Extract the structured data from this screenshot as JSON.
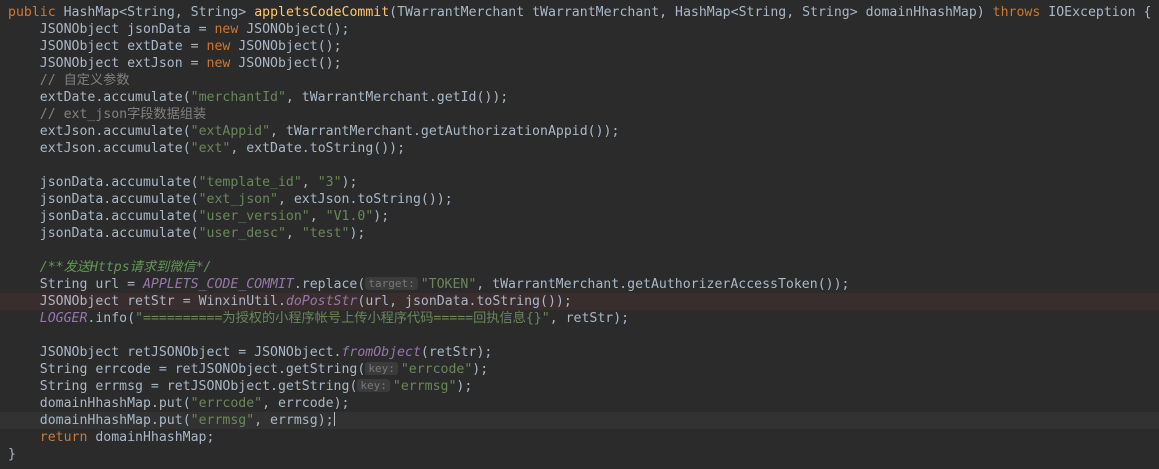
{
  "code_lines": [
    {
      "tokens": [
        [
          "kw",
          "public"
        ],
        [
          "plain",
          " "
        ],
        [
          "type",
          "HashMap"
        ],
        [
          "plain",
          "<"
        ],
        [
          "type",
          "String"
        ],
        [
          "plain",
          ", "
        ],
        [
          "type",
          "String"
        ],
        [
          "plain",
          "> "
        ],
        [
          "method",
          "appletsCodeCommit"
        ],
        [
          "plain",
          "("
        ],
        [
          "type",
          "TWarrantMerchant"
        ],
        [
          "plain",
          " tWarrantMerchant, "
        ],
        [
          "type",
          "HashMap"
        ],
        [
          "plain",
          "<"
        ],
        [
          "type",
          "String"
        ],
        [
          "plain",
          ", "
        ],
        [
          "type",
          "String"
        ],
        [
          "plain",
          "> domainHhashMap) "
        ],
        [
          "kw",
          "throws"
        ],
        [
          "plain",
          " "
        ],
        [
          "type",
          "IOException"
        ],
        [
          "plain",
          " {"
        ]
      ]
    },
    {
      "tokens": [
        [
          "plain",
          "    "
        ],
        [
          "type",
          "JSONObject"
        ],
        [
          "plain",
          " jsonData = "
        ],
        [
          "kw",
          "new"
        ],
        [
          "plain",
          " "
        ],
        [
          "type",
          "JSONObject"
        ],
        [
          "plain",
          "();"
        ]
      ]
    },
    {
      "tokens": [
        [
          "plain",
          "    "
        ],
        [
          "type",
          "JSONObject"
        ],
        [
          "plain",
          " extDate = "
        ],
        [
          "kw",
          "new"
        ],
        [
          "plain",
          " "
        ],
        [
          "type",
          "JSONObject"
        ],
        [
          "plain",
          "();"
        ]
      ]
    },
    {
      "tokens": [
        [
          "plain",
          "    "
        ],
        [
          "type",
          "JSONObject"
        ],
        [
          "plain",
          " extJson = "
        ],
        [
          "kw",
          "new"
        ],
        [
          "plain",
          " "
        ],
        [
          "type",
          "JSONObject"
        ],
        [
          "plain",
          "();"
        ]
      ]
    },
    {
      "tokens": [
        [
          "plain",
          "    "
        ],
        [
          "comment",
          "// 自定义参数"
        ]
      ]
    },
    {
      "tokens": [
        [
          "plain",
          "    extDate."
        ],
        [
          "call",
          "accumulate"
        ],
        [
          "plain",
          "("
        ],
        [
          "str",
          "\"merchantId\""
        ],
        [
          "plain",
          ", tWarrantMerchant."
        ],
        [
          "call",
          "getId"
        ],
        [
          "plain",
          "());"
        ]
      ]
    },
    {
      "tokens": [
        [
          "plain",
          "    "
        ],
        [
          "comment",
          "// ext_json字段数据组装"
        ]
      ]
    },
    {
      "tokens": [
        [
          "plain",
          "    extJson."
        ],
        [
          "call",
          "accumulate"
        ],
        [
          "plain",
          "("
        ],
        [
          "str",
          "\"extAppid\""
        ],
        [
          "plain",
          ", tWarrantMerchant."
        ],
        [
          "call",
          "getAuthorizationAppid"
        ],
        [
          "plain",
          "());"
        ]
      ]
    },
    {
      "tokens": [
        [
          "plain",
          "    extJson."
        ],
        [
          "call",
          "accumulate"
        ],
        [
          "plain",
          "("
        ],
        [
          "str",
          "\"ext\""
        ],
        [
          "plain",
          ", extDate."
        ],
        [
          "call",
          "toString"
        ],
        [
          "plain",
          "());"
        ]
      ]
    },
    {
      "tokens": [
        [
          "plain",
          ""
        ]
      ]
    },
    {
      "tokens": [
        [
          "plain",
          "    jsonData."
        ],
        [
          "call",
          "accumulate"
        ],
        [
          "plain",
          "("
        ],
        [
          "str",
          "\"template_id\""
        ],
        [
          "plain",
          ", "
        ],
        [
          "str",
          "\"3\""
        ],
        [
          "plain",
          ");"
        ]
      ]
    },
    {
      "tokens": [
        [
          "plain",
          "    jsonData."
        ],
        [
          "call",
          "accumulate"
        ],
        [
          "plain",
          "("
        ],
        [
          "str",
          "\"ext_json\""
        ],
        [
          "plain",
          ", extJson."
        ],
        [
          "call",
          "toString"
        ],
        [
          "plain",
          "());"
        ]
      ]
    },
    {
      "tokens": [
        [
          "plain",
          "    jsonData."
        ],
        [
          "call",
          "accumulate"
        ],
        [
          "plain",
          "("
        ],
        [
          "str",
          "\"user_version\""
        ],
        [
          "plain",
          ", "
        ],
        [
          "str",
          "\"V1.0\""
        ],
        [
          "plain",
          ");"
        ]
      ]
    },
    {
      "tokens": [
        [
          "plain",
          "    jsonData."
        ],
        [
          "call",
          "accumulate"
        ],
        [
          "plain",
          "("
        ],
        [
          "str",
          "\"user_desc\""
        ],
        [
          "plain",
          ", "
        ],
        [
          "str",
          "\"test\""
        ],
        [
          "plain",
          ");"
        ]
      ]
    },
    {
      "tokens": [
        [
          "plain",
          ""
        ]
      ]
    },
    {
      "tokens": [
        [
          "plain",
          "    "
        ],
        [
          "doc",
          "/**发送Https请求到微信*/"
        ]
      ]
    },
    {
      "tokens": [
        [
          "plain",
          "    "
        ],
        [
          "type",
          "String"
        ],
        [
          "plain",
          " url = "
        ],
        [
          "field",
          "APPLETS_CODE_COMMIT"
        ],
        [
          "plain",
          "."
        ],
        [
          "call",
          "replace"
        ],
        [
          "plain",
          "("
        ],
        [
          "hint",
          "target:"
        ],
        [
          "str",
          "\"TOKEN\""
        ],
        [
          "plain",
          ", tWarrantMerchant."
        ],
        [
          "call",
          "getAuthorizerAccessToken"
        ],
        [
          "plain",
          "());"
        ]
      ]
    },
    {
      "highlight": true,
      "tokens": [
        [
          "plain",
          "    "
        ],
        [
          "type",
          "JSONObject"
        ],
        [
          "plain",
          " retStr = WinxinUtil."
        ],
        [
          "field",
          "doPostStr"
        ],
        [
          "plain",
          "(url, jsonData."
        ],
        [
          "call",
          "toString"
        ],
        [
          "plain",
          "());"
        ]
      ]
    },
    {
      "tokens": [
        [
          "plain",
          "    "
        ],
        [
          "field",
          "LOGGER"
        ],
        [
          "plain",
          "."
        ],
        [
          "call",
          "info"
        ],
        [
          "plain",
          "("
        ],
        [
          "str",
          "\"==========为授权的小程序帐号上传小程序代码=====回执信息{}\""
        ],
        [
          "plain",
          ", retStr);"
        ]
      ]
    },
    {
      "tokens": [
        [
          "plain",
          ""
        ]
      ]
    },
    {
      "tokens": [
        [
          "plain",
          "    "
        ],
        [
          "type",
          "JSONObject"
        ],
        [
          "plain",
          " retJSONObject = JSONObject."
        ],
        [
          "field",
          "fromObject"
        ],
        [
          "plain",
          "(retStr);"
        ]
      ]
    },
    {
      "tokens": [
        [
          "plain",
          "    "
        ],
        [
          "type",
          "String"
        ],
        [
          "plain",
          " errcode = retJSONObject."
        ],
        [
          "call",
          "getString"
        ],
        [
          "plain",
          "("
        ],
        [
          "hint",
          "key:"
        ],
        [
          "str",
          "\"errcode\""
        ],
        [
          "plain",
          ");"
        ]
      ]
    },
    {
      "tokens": [
        [
          "plain",
          "    "
        ],
        [
          "type",
          "String"
        ],
        [
          "plain",
          " errmsg = retJSONObject."
        ],
        [
          "call",
          "getString"
        ],
        [
          "plain",
          "("
        ],
        [
          "hint",
          "key:"
        ],
        [
          "str",
          "\"errmsg\""
        ],
        [
          "plain",
          ");"
        ]
      ]
    },
    {
      "tokens": [
        [
          "plain",
          "    domainHhashMap."
        ],
        [
          "call",
          "put"
        ],
        [
          "plain",
          "("
        ],
        [
          "str",
          "\"errcode\""
        ],
        [
          "plain",
          ", errcode);"
        ]
      ]
    },
    {
      "current": true,
      "tokens": [
        [
          "plain",
          "    domainHhashMap."
        ],
        [
          "call",
          "put"
        ],
        [
          "plain",
          "("
        ],
        [
          "str",
          "\"errmsg\""
        ],
        [
          "plain",
          ", errmsg);"
        ]
      ]
    },
    {
      "tokens": [
        [
          "plain",
          "    "
        ],
        [
          "kw",
          "return"
        ],
        [
          "plain",
          " domainHhashMap;"
        ]
      ]
    },
    {
      "tokens": [
        [
          "plain",
          "}"
        ]
      ]
    }
  ]
}
